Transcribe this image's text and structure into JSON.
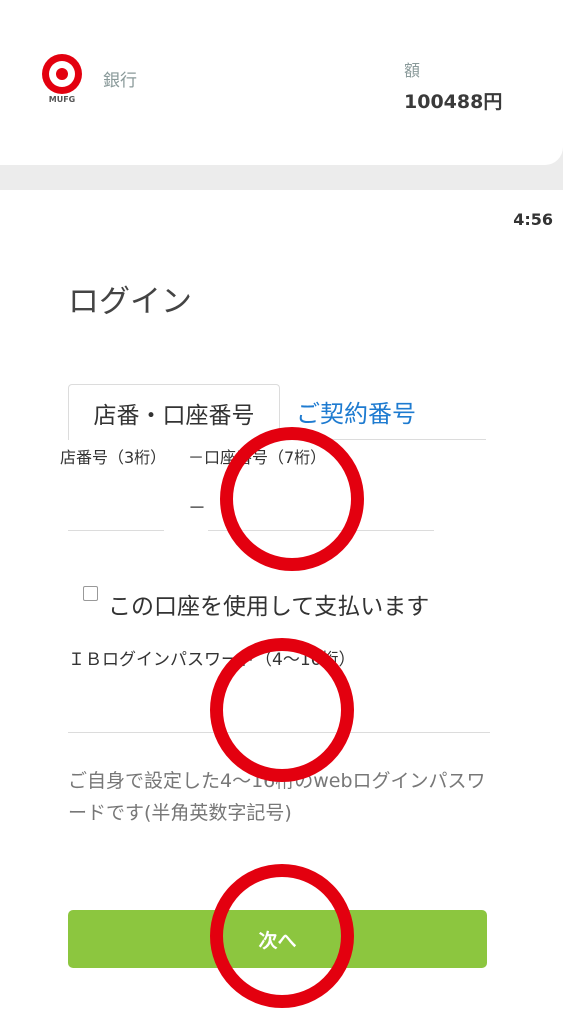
{
  "header": {
    "bank_name": "銀行",
    "logo_text": "MUFG",
    "amount_label": "額",
    "amount_value": "100488円"
  },
  "timer": "4:56",
  "login": {
    "title": "ログイン",
    "tabs": [
      {
        "label": "店番・口座番号",
        "active": true
      },
      {
        "label": "ご契約番号",
        "active": false
      }
    ],
    "branch_label": "店番号（3桁）",
    "account_label": "－口座番号（7桁）",
    "dash": "－",
    "checkbox_label": "この口座を使用して支払います",
    "password_label": "ＩＢログインパスワード（4～16桁）",
    "hint": "ご自身で設定した4～16桁のwebログインパスワードです(半角英数字記号)",
    "next_button": "次へ"
  },
  "colors": {
    "accent_green": "#8cc63f",
    "link_blue": "#1e7bd0",
    "annotation_red": "#e3000f"
  }
}
